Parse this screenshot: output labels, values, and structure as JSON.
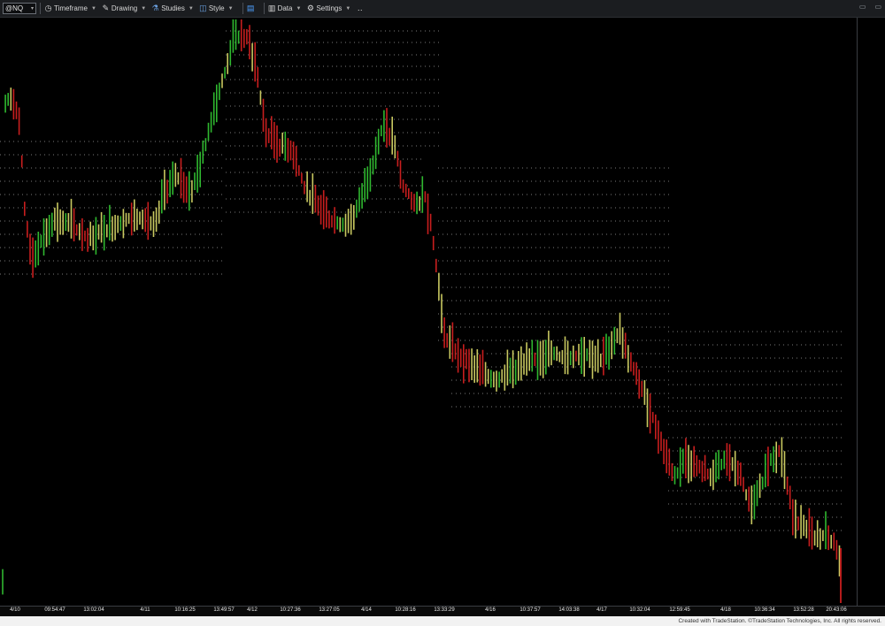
{
  "toolbar": {
    "symbol": "@NQ",
    "items": [
      {
        "label": "Timeframe",
        "icon": "clock-icon"
      },
      {
        "label": "Drawing",
        "icon": "pencil-icon"
      },
      {
        "label": "Studies",
        "icon": "flask-icon"
      },
      {
        "label": "Style",
        "icon": "style-icon"
      },
      {
        "label": "Data",
        "icon": "bar-chart-icon"
      },
      {
        "label": "Settings",
        "icon": "gear-icon"
      }
    ]
  },
  "time_axis": {
    "labels": [
      "4/10",
      "09:54:47",
      "13:02:04",
      "4/11",
      "10:16:25",
      "13:49:57",
      "4/12",
      "10:27:36",
      "13:27:05",
      "4/14",
      "10:28:16",
      "13:33:29",
      "4/16",
      "10:37:57",
      "14:03:38",
      "4/17",
      "10:32:04",
      "12:59:45",
      "4/18",
      "10:36:34",
      "13:52:28",
      "20:43:06"
    ]
  },
  "footer": {
    "copyright": "Created with TradeStation. ©TradeStation Technologies, Inc. All rights reserved."
  },
  "colors": {
    "background": "#000000",
    "bar_up": "#2fb82f",
    "bar_down": "#c81e1e",
    "bar_neutral": "#c8c860",
    "level_dots": "#7a7a7a"
  }
}
